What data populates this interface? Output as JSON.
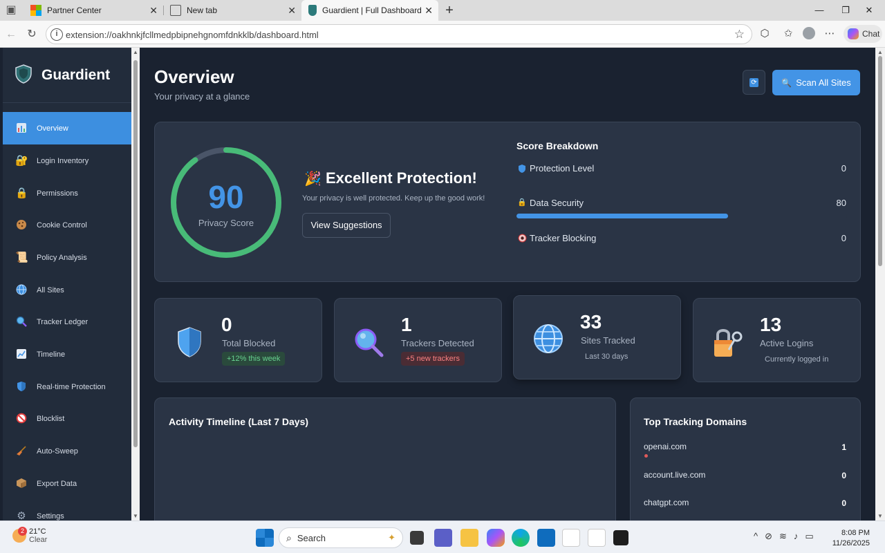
{
  "browser": {
    "tabs": [
      {
        "title": "Partner Center"
      },
      {
        "title": "New tab"
      },
      {
        "title": "Guardient | Full Dashboard"
      }
    ],
    "url": "extension://oakhnkjfcllmedpbipnehgnomfdnkklb/dashboard.html",
    "chat_label": "Chat"
  },
  "sidebar": {
    "brand": "Guardient",
    "items": [
      {
        "label": "Overview",
        "icon": "chart-icon"
      },
      {
        "label": "Login Inventory",
        "icon": "lock-key-icon"
      },
      {
        "label": "Permissions",
        "icon": "lock-icon"
      },
      {
        "label": "Cookie Control",
        "icon": "cookie-icon"
      },
      {
        "label": "Policy Analysis",
        "icon": "scroll-icon"
      },
      {
        "label": "All Sites",
        "icon": "globe-icon"
      },
      {
        "label": "Tracker Ledger",
        "icon": "magnifier-icon"
      },
      {
        "label": "Timeline",
        "icon": "trend-chart-icon"
      },
      {
        "label": "Real-time Protection",
        "icon": "shield-icon"
      },
      {
        "label": "Blocklist",
        "icon": "prohibited-icon"
      },
      {
        "label": "Auto-Sweep",
        "icon": "broom-icon"
      },
      {
        "label": "Export Data",
        "icon": "package-icon"
      },
      {
        "label": "Settings",
        "icon": "gear-icon"
      }
    ]
  },
  "header": {
    "title": "Overview",
    "subtitle": "Your privacy at a glance",
    "scan_label": "Scan All Sites"
  },
  "score": {
    "value": "90",
    "label": "Privacy Score",
    "fraction": 0.9,
    "headline": "Excellent Protection!",
    "message": "Your privacy is well protected. Keep up the good work!",
    "suggestions_label": "View Suggestions",
    "breakdown_title": "Score Breakdown",
    "breakdown": [
      {
        "label": "Protection Level",
        "value": "0",
        "fraction": 0
      },
      {
        "label": "Data Security",
        "value": "80",
        "fraction": 0.8
      },
      {
        "label": "Tracker Blocking",
        "value": "0",
        "fraction": 0
      }
    ]
  },
  "stats": [
    {
      "value": "0",
      "label": "Total Blocked",
      "badge": "+12% this week"
    },
    {
      "value": "1",
      "label": "Trackers Detected",
      "badge": "+5 new trackers"
    },
    {
      "value": "33",
      "label": "Sites Tracked",
      "note": "Last 30 days"
    },
    {
      "value": "13",
      "label": "Active Logins",
      "note": "Currently logged in"
    }
  ],
  "activity": {
    "title": "Activity Timeline (Last 7 Days)"
  },
  "domains": {
    "title": "Top Tracking Domains",
    "items": [
      {
        "name": "openai.com",
        "count": "1"
      },
      {
        "name": "account.live.com",
        "count": "0"
      },
      {
        "name": "chatgpt.com",
        "count": "0"
      }
    ]
  },
  "taskbar": {
    "temp": "21°C",
    "condition": "Clear",
    "weather_badge": "2",
    "search": "Search",
    "time": "8:08 PM",
    "date": "11/26/2025"
  },
  "colors": {
    "accent": "#4394e6",
    "good": "#48bb78",
    "bad": "#e05a5a"
  }
}
